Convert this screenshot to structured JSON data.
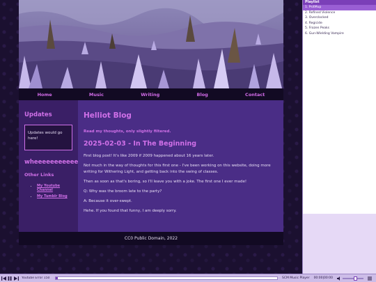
{
  "nav": {
    "items": [
      "Home",
      "Music",
      "Writing",
      "Blog",
      "Contact"
    ]
  },
  "sidebar": {
    "updates_heading": "Updates",
    "updates_text": "Updates would go here!",
    "tagline": "wheeeeeeeeeee",
    "other_links_heading": "Other Links",
    "links": [
      "My Youtube Channel",
      "My Tumblr Blog"
    ]
  },
  "main": {
    "blog_title": "Helliot Blog",
    "blog_subtitle": "Read my thoughts, only slightly filtered.",
    "post_title": "2025-02-03 - In The Beginning",
    "paragraphs": [
      "First blog post! It's like 2009 if 2009 happened about 16 years later.",
      "Not much in the way of thoughts for this first one - I've been working on this website, doing more writing for Withering Light, and getting back into the swing of classes.",
      "Then as soon as that's boring, so I'll leave you with a joke. The first one I ever made!",
      "Q: Why was the broom late to the party?",
      "A: Because it over-swept.",
      "Hehe. If you found that funny, I am deeply sorry."
    ]
  },
  "footer": {
    "text": "CC0 Public Domain, 2022"
  },
  "playlist": {
    "title": "Playlist",
    "items": [
      "1. PsitMup",
      "2. Refined Violence",
      "3. Overclocked",
      "4. Regicide",
      "5. Frozen Peaks",
      "6. Gun-Wielding Vampire"
    ],
    "active_index": 0
  },
  "player": {
    "track_label": "Youtube Error 150",
    "player_name": "SCM Music Player",
    "time": "00:00|00:00",
    "progress": 0.0,
    "volume": 0.6
  },
  "colors": {
    "accent": "#d070e8",
    "sidebar_bg": "#3a1f66",
    "main_bg": "#4a2d86",
    "nav_bg": "#120a23",
    "playlist_active": "#9a5fd4"
  }
}
